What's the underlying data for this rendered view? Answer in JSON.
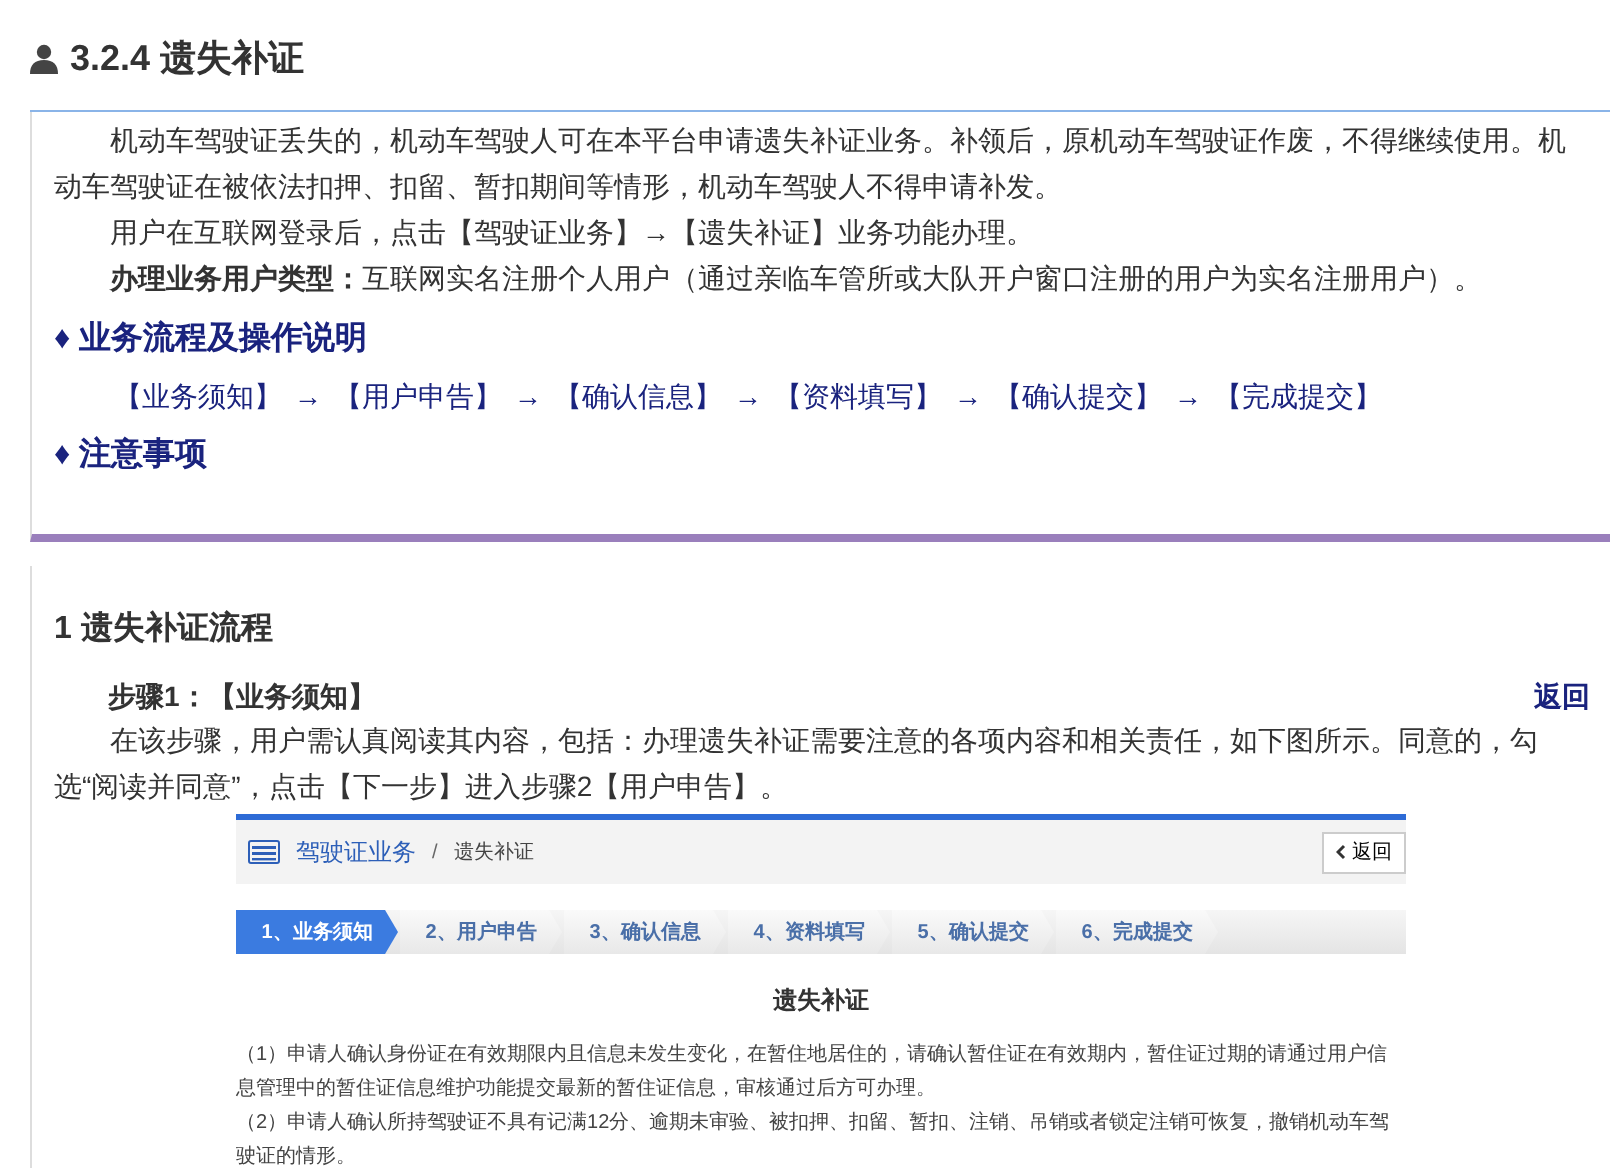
{
  "heading": {
    "title": "3.2.4 遗失补证"
  },
  "intro": [
    "机动车驾驶证丢失的，机动车驾驶人可在本平台申请遗失补证业务。补领后，原机动车驾驶证作废，不得继续使用。机动车驾驶证在被依法扣押、扣留、暂扣期间等情形，机动车驾驶人不得申请补发。",
    "用户在互联网登录后，点击【驾驶证业务】→【遗失补证】业务功能办理。",
    "**办理业务用户类型：**互联网实名注册个人用户（通过亲临车管所或大队开户窗口注册的用户为实名注册用户）。"
  ],
  "subsections": [
    {
      "bullet": "♦",
      "title": "业务流程及操作说明",
      "flow": [
        "【业务须知】",
        "【用户申告】",
        "【确认信息】",
        "【资料填写】",
        "【确认提交】",
        "【完成提交】"
      ],
      "flow_arrow": "→"
    },
    {
      "bullet": "♦",
      "title": "注意事项"
    }
  ],
  "section": {
    "title": "1 遗失补证流程",
    "step_title": "步骤1：【业务须知】",
    "back_link": "返回",
    "text": "在该步骤，用户需认真阅读其内容，包括：办理遗失补证需要注意的各项内容和相关责任，如下图所示。同意的，勾选“阅读并同意”，点击【下一步】进入步骤2【用户申告】。"
  },
  "screenshot": {
    "breadcrumb": {
      "module": "驾驶证业务",
      "separator": "/",
      "page": "遗失补证"
    },
    "back_button": "返回",
    "steps": [
      {
        "label": "1、业务须知",
        "selected": true
      },
      {
        "label": "2、用户申告",
        "selected": false
      },
      {
        "label": "3、确认信息",
        "selected": false
      },
      {
        "label": "4、资料填写",
        "selected": false
      },
      {
        "label": "5、确认提交",
        "selected": false
      },
      {
        "label": "6、完成提交",
        "selected": false
      }
    ],
    "title": "遗失补证",
    "items": [
      "（1）申请人确认身份证在有效期限内且信息未发生变化，在暂住地居住的，请确认暂住证在有效期内，暂住证过期的请通过用户信息管理中的暂住证信息维护功能提交最新的暂住证信息，审核通过后方可办理。",
      "（2）申请人确认所持驾驶证不具有记满12分、逾期未审验、被扣押、扣留、暂扣、注销、吊销或者锁定注销可恢复，撤销机动车驾驶证的情形。"
    ]
  }
}
